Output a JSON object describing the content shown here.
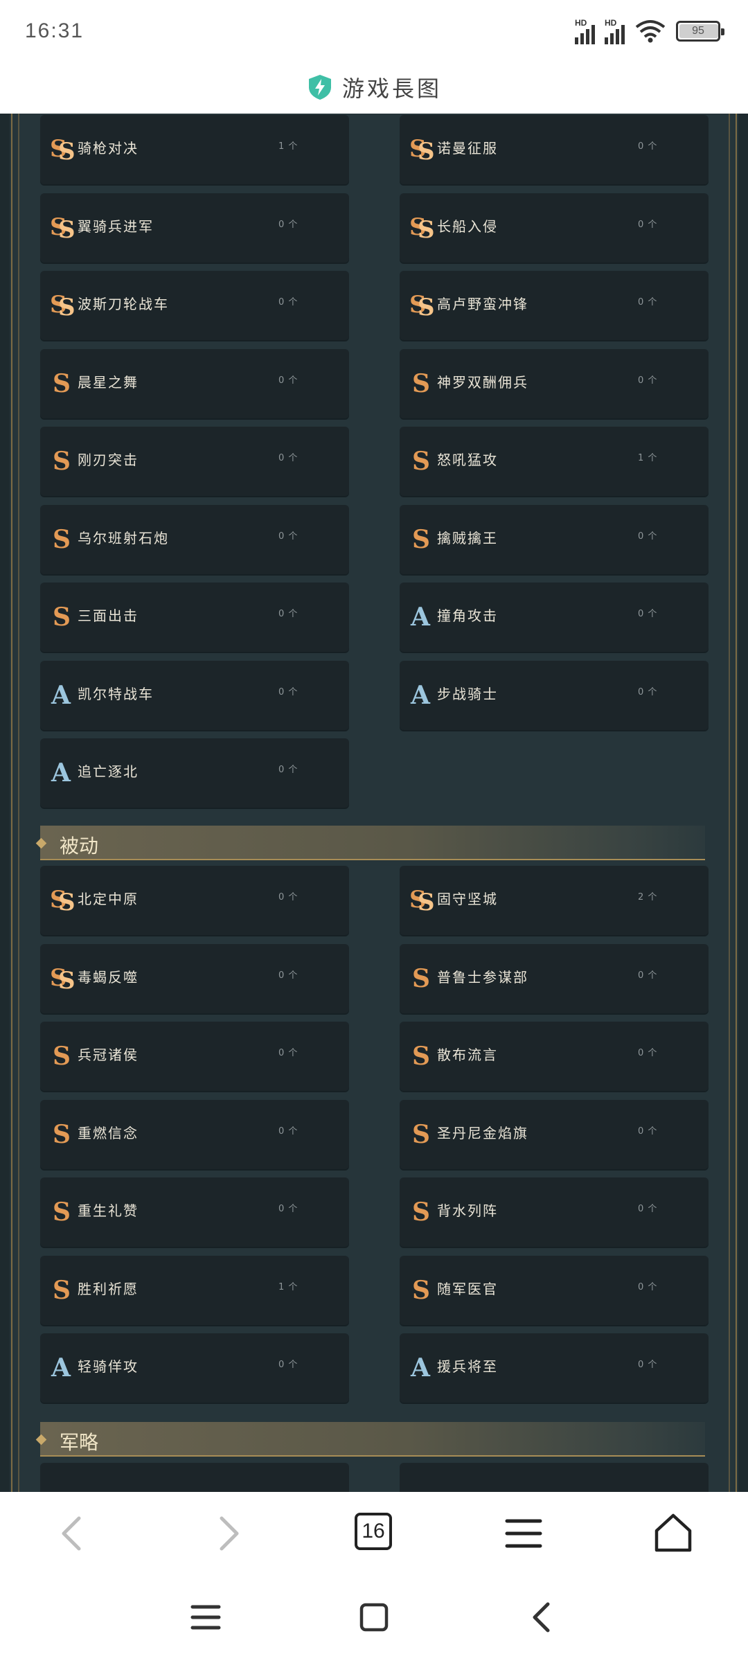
{
  "status_bar": {
    "time": "16:31",
    "network_label": "HD",
    "battery_level": "95"
  },
  "site": {
    "title": "游戏長图"
  },
  "sections": {
    "passive": {
      "title": "被动"
    },
    "strategy": {
      "title": "军略"
    }
  },
  "active_rows": [
    {
      "left": {
        "grade": "SS",
        "name": "骑枪对决",
        "level": "1 个"
      },
      "right": {
        "grade": "SS",
        "name": "诺曼征服",
        "level": "0 个"
      }
    },
    {
      "left": {
        "grade": "SS",
        "name": "翼骑兵进军",
        "level": "0 个"
      },
      "right": {
        "grade": "SS",
        "name": "长船入侵",
        "level": "0 个"
      }
    },
    {
      "left": {
        "grade": "SS",
        "name": "波斯刀轮战车",
        "level": "0 个"
      },
      "right": {
        "grade": "SS",
        "name": "高卢野蛮冲锋",
        "level": "0 个"
      }
    },
    {
      "left": {
        "grade": "S",
        "name": "晨星之舞",
        "level": "0 个"
      },
      "right": {
        "grade": "S",
        "name": "神罗双酬佣兵",
        "level": "0 个"
      }
    },
    {
      "left": {
        "grade": "S",
        "name": "刚刃突击",
        "level": "0 个"
      },
      "right": {
        "grade": "S",
        "name": "怒吼猛攻",
        "level": "1 个"
      }
    },
    {
      "left": {
        "grade": "S",
        "name": "乌尔班射石炮",
        "level": "0 个"
      },
      "right": {
        "grade": "S",
        "name": "擒贼擒王",
        "level": "0 个"
      }
    },
    {
      "left": {
        "grade": "S",
        "name": "三面出击",
        "level": "0 个"
      },
      "right": {
        "grade": "A",
        "name": "撞角攻击",
        "level": "0 个"
      }
    },
    {
      "left": {
        "grade": "A",
        "name": "凯尔特战车",
        "level": "0 个"
      },
      "right": {
        "grade": "A",
        "name": "步战骑士",
        "level": "0 个"
      }
    },
    {
      "left": {
        "grade": "A",
        "name": "追亡逐北",
        "level": "0 个"
      },
      "right": null
    }
  ],
  "passive_rows": [
    {
      "left": {
        "grade": "SS",
        "name": "北定中原",
        "level": "0 个"
      },
      "right": {
        "grade": "SS",
        "name": "固守坚城",
        "level": "2 个"
      }
    },
    {
      "left": {
        "grade": "SS",
        "name": "毒蝎反噬",
        "level": "0 个"
      },
      "right": {
        "grade": "S",
        "name": "普鲁士参谋部",
        "level": "0 个"
      }
    },
    {
      "left": {
        "grade": "S",
        "name": "兵冠诸侯",
        "level": "0 个"
      },
      "right": {
        "grade": "S",
        "name": "散布流言",
        "level": "0 个"
      }
    },
    {
      "left": {
        "grade": "S",
        "name": "重燃信念",
        "level": "0 个"
      },
      "right": {
        "grade": "S",
        "name": "圣丹尼金焰旗",
        "level": "0 个"
      }
    },
    {
      "left": {
        "grade": "S",
        "name": "重生礼赞",
        "level": "0 个"
      },
      "right": {
        "grade": "S",
        "name": "背水列阵",
        "level": "0 个"
      }
    },
    {
      "left": {
        "grade": "S",
        "name": "胜利祈愿",
        "level": "1 个"
      },
      "right": {
        "grade": "S",
        "name": "随军医官",
        "level": "0 个"
      }
    },
    {
      "left": {
        "grade": "A",
        "name": "轻骑佯攻",
        "level": "0 个"
      },
      "right": {
        "grade": "A",
        "name": "援兵将至",
        "level": "0 个"
      }
    }
  ],
  "browser_nav": {
    "tabs_count": "16"
  },
  "colors": {
    "page_bg": "#26353a",
    "card_bg": "#1c2529",
    "accent_gold": "#a88d56",
    "grade_s": "#e39a55",
    "grade_a": "#9cc6de"
  }
}
